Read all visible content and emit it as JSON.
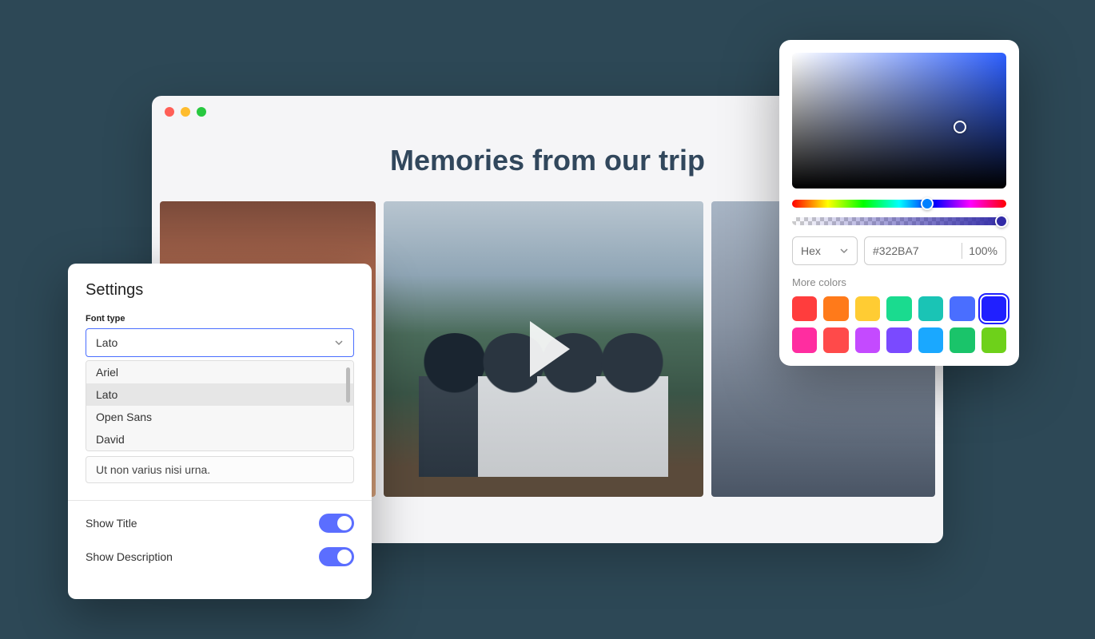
{
  "browser": {
    "page_title": "Memories from our trip"
  },
  "settings": {
    "title": "Settings",
    "font_type_label": "Font type",
    "font_selected": "Lato",
    "font_options": [
      "Ariel",
      "Lato",
      "Open Sans",
      "David"
    ],
    "text_value": "Ut non varius nisi urna.",
    "show_title_label": "Show Title",
    "show_title_on": true,
    "show_description_label": "Show Description",
    "show_description_on": true
  },
  "color_picker": {
    "format": "Hex",
    "hex": "#322BA7",
    "opacity": "100%",
    "more_colors_label": "More colors",
    "swatches": [
      {
        "color": "#ff3d3d",
        "selected": false
      },
      {
        "color": "#ff7a1a",
        "selected": false
      },
      {
        "color": "#ffcc33",
        "selected": false
      },
      {
        "color": "#1adb8f",
        "selected": false
      },
      {
        "color": "#1ac4b5",
        "selected": false
      },
      {
        "color": "#4a6eff",
        "selected": false
      },
      {
        "color": "#2020ff",
        "selected": true
      },
      {
        "color": "#ff2da0",
        "selected": false
      },
      {
        "color": "#ff4a4a",
        "selected": false
      },
      {
        "color": "#c44aff",
        "selected": false
      },
      {
        "color": "#7a4aff",
        "selected": false
      },
      {
        "color": "#1aa8ff",
        "selected": false
      },
      {
        "color": "#1ac46a",
        "selected": false
      },
      {
        "color": "#6ed11a",
        "selected": false
      }
    ]
  }
}
